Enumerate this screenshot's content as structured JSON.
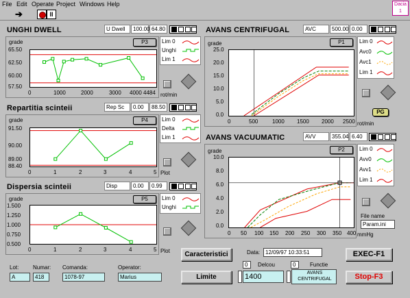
{
  "menu": [
    "File",
    "Edit",
    "Operate",
    "Project",
    "Windows",
    "Help"
  ],
  "badge": {
    "line1": "Dacia",
    "line2": "1"
  },
  "toolbar": {
    "run_icon": "run-arrow-icon",
    "stop_icon": "abort-icon",
    "pause_icon": "pause-icon",
    "pause_glyph": "II"
  },
  "colors": {
    "red": "#e00000",
    "green": "#00c000",
    "dark_green": "#008000",
    "orange": "#ffa500",
    "cursor": "#404040",
    "cyan_field": "#c8f0f0"
  },
  "panels": {
    "unghi": {
      "title": "UNGHI DWELL",
      "readout_name": "U Dwell",
      "readout_v1": "100.00",
      "readout_v2": "64.80",
      "ybtn": "P3",
      "unit_y": "grade",
      "unit_x": "rot/min",
      "legend": [
        "Lim 0",
        "Unghi",
        "Lim 1"
      ],
      "yticks": [
        "65.50",
        "62.50",
        "60.00",
        "57.50"
      ],
      "xticks": [
        "0",
        "1000",
        "2000",
        "3000",
        "4000",
        "4484"
      ]
    },
    "repartitia": {
      "title": "Repartitia scinteii",
      "readout_name": "Rep Sc",
      "readout_v1": "0.00",
      "readout_v2": "88.50",
      "ybtn": "P4",
      "unit_y": "grade",
      "unit_x": "Plot",
      "legend": [
        "Lim 0",
        "Delta",
        "Lim 1"
      ],
      "yticks": [
        "91.50",
        "90.00",
        "89.00",
        "88.40"
      ],
      "xticks": [
        "0",
        "1",
        "2",
        "3",
        "4",
        "5"
      ]
    },
    "dispersia": {
      "title": "Dispersia scinteii",
      "readout_name": "Disp",
      "readout_v1": "0.00",
      "readout_v2": "0.99",
      "ybtn": "P5",
      "unit_y": "grade",
      "unit_x": "Plot",
      "legend": [
        "Lim 0",
        "Unghi"
      ],
      "yticks": [
        "1.500",
        "1.250",
        "1.000",
        "0.750",
        "0.500"
      ],
      "xticks": [
        "0",
        "1",
        "2",
        "3",
        "4",
        "5"
      ]
    },
    "centrifugal": {
      "title": "AVANS CENTRIFUGAL",
      "readout_name": "AVC",
      "readout_v1": "500.00",
      "readout_v2": "0.00",
      "ybtn": "P1",
      "unit_y": "grade",
      "unit_x": "rot/min",
      "legend": [
        "Lim 0",
        "Avc0",
        "Avc1",
        "Lim 1"
      ],
      "yticks": [
        "25.0",
        "20.0",
        "15.0",
        "10.0",
        "5.0",
        "0.0"
      ],
      "xticks": [
        "0",
        "500",
        "1000",
        "1500",
        "2000",
        "2500"
      ],
      "pg": "PG"
    },
    "vacuumatic": {
      "title": "AVANS VACUUMATIC",
      "readout_name": "AVV",
      "readout_v1": "355.04",
      "readout_v2": "6.40",
      "ybtn": "P2",
      "unit_y": "grade",
      "unit_x": "mmHg",
      "legend": [
        "Lim 0",
        "Avv0",
        "Avv1",
        "Lim 1"
      ],
      "yticks": [
        "10.0",
        "8.0",
        "6.0",
        "4.0",
        "2.0",
        "0.0"
      ],
      "xticks": [
        "0",
        "50",
        "100",
        "150",
        "200",
        "250",
        "300",
        "350",
        "400"
      ],
      "file_label": "File name",
      "file_value": "Param.ini"
    }
  },
  "chart_data": [
    {
      "name": "UNGHI DWELL",
      "type": "line",
      "xlim": [
        0,
        4484
      ],
      "ylim": [
        57.5,
        65.5
      ],
      "series": [
        {
          "name": "Lim 0",
          "x": [
            0,
            4484
          ],
          "y": [
            64.5,
            64.5
          ]
        },
        {
          "name": "Unghi",
          "x": [
            500,
            800,
            1000,
            1200,
            1500,
            2000,
            2500,
            3500,
            4000
          ],
          "y": [
            62.9,
            63.6,
            58.9,
            63.0,
            63.4,
            63.6,
            62.3,
            63.8,
            59.4
          ]
        },
        {
          "name": "Lim 1",
          "x": [
            0,
            4484
          ],
          "y": [
            58.4,
            58.4
          ]
        }
      ]
    },
    {
      "name": "Repartitia scinteii",
      "type": "line",
      "xlim": [
        0,
        5
      ],
      "ylim": [
        88.4,
        91.5
      ],
      "series": [
        {
          "name": "Lim 0",
          "x": [
            0,
            5
          ],
          "y": [
            91.3,
            91.3
          ]
        },
        {
          "name": "Delta",
          "x": [
            1,
            2,
            3,
            4
          ],
          "y": [
            89.0,
            91.3,
            89.0,
            90.3
          ]
        },
        {
          "name": "Lim 1",
          "x": [
            0,
            5
          ],
          "y": [
            88.5,
            88.5
          ]
        }
      ]
    },
    {
      "name": "Dispersia scinteii",
      "type": "line",
      "xlim": [
        0,
        5
      ],
      "ylim": [
        0.5,
        1.5
      ],
      "series": [
        {
          "name": "Lim 0",
          "x": [
            0,
            5
          ],
          "y": [
            1.0,
            1.0
          ]
        },
        {
          "name": "Unghi",
          "x": [
            1,
            2,
            3,
            4
          ],
          "y": [
            0.93,
            1.28,
            0.92,
            0.55
          ]
        }
      ]
    },
    {
      "name": "AVANS CENTRIFUGAL",
      "type": "line",
      "xlim": [
        0,
        2500
      ],
      "ylim": [
        0,
        25
      ],
      "series": [
        {
          "name": "Lim 0",
          "x": [
            300,
            1750,
            2400
          ],
          "y": [
            0,
            18.5,
            18.5
          ]
        },
        {
          "name": "Avc0",
          "x": [
            450,
            1000,
            1500,
            1800,
            2400
          ],
          "y": [
            0.5,
            8.5,
            14.5,
            17.0,
            17.0
          ]
        },
        {
          "name": "Avc1",
          "x": [
            450,
            1000,
            1500,
            1800,
            2400
          ],
          "y": [
            0,
            7.5,
            13.5,
            16.0,
            16.0
          ]
        },
        {
          "name": "Lim 1",
          "x": [
            500,
            1800,
            2400
          ],
          "y": [
            0,
            15.5,
            15.5
          ]
        }
      ]
    },
    {
      "name": "AVANS VACUUMATIC",
      "type": "line",
      "xlim": [
        0,
        400
      ],
      "ylim": [
        0,
        10
      ],
      "series": [
        {
          "name": "Lim 0",
          "x": [
            50,
            100,
            250,
            355,
            400
          ],
          "y": [
            0,
            2.5,
            5.5,
            6.4,
            6.4
          ]
        },
        {
          "name": "Avv0",
          "x": [
            60,
            100,
            160,
            260,
            355,
            390
          ],
          "y": [
            0,
            1.8,
            4.0,
            5.3,
            6.4,
            6.4
          ]
        },
        {
          "name": "Avv1",
          "x": [
            70,
            120,
            190,
            280,
            355,
            390
          ],
          "y": [
            0,
            1.2,
            3.0,
            4.8,
            5.8,
            5.8
          ]
        },
        {
          "name": "Lim 1",
          "x": [
            100,
            150,
            250,
            330,
            390
          ],
          "y": [
            0,
            1.3,
            2.3,
            4.0,
            4.0
          ]
        }
      ]
    }
  ],
  "bottom": {
    "lot_label": "Lot:",
    "lot_value": "A",
    "numar_label": "Numar:",
    "numar_value": "418",
    "comanda_label": "Comanda:",
    "comanda_value": "1078-97",
    "operator_label": "Operator:",
    "operator_value": "Marius",
    "caracteristici": "Caracteristici",
    "limite": "Limite",
    "data_label": "Data:",
    "data_value": "12/09/97   10:33:51",
    "delcou_label": "Delcou",
    "delcou_value": "0",
    "functie_label": "Functie",
    "functie_value": "0",
    "rpm_value": "1400",
    "mode_value": "AVANS CENTRIFUGAL",
    "exec": "EXEC-F1",
    "stop": "Stop-F3"
  }
}
